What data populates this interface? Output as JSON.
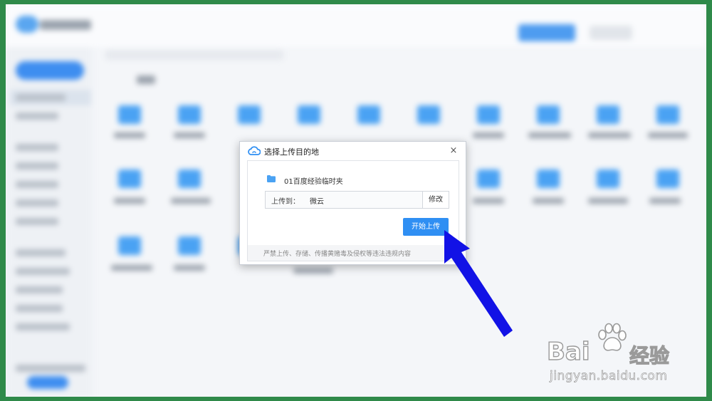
{
  "dialog": {
    "title": "选择上传目的地",
    "close_glyph": "×",
    "folder_name": "01百度经验临时夹",
    "dest_label": "上传到：",
    "dest_value": "微云",
    "modify_label": "修改",
    "start_label": "开始上传",
    "notice": "严禁上传、存储、传播黄赌毒及侵权等违法违规内容"
  },
  "watermark": {
    "brand_left": "Bai",
    "brand_right": "经验",
    "url": "jingyan.baidu.com"
  },
  "colors": {
    "primary_blue": "#2f8ff3",
    "annotation_arrow": "#1010e0",
    "folder_blue": "#4aa2f3"
  }
}
